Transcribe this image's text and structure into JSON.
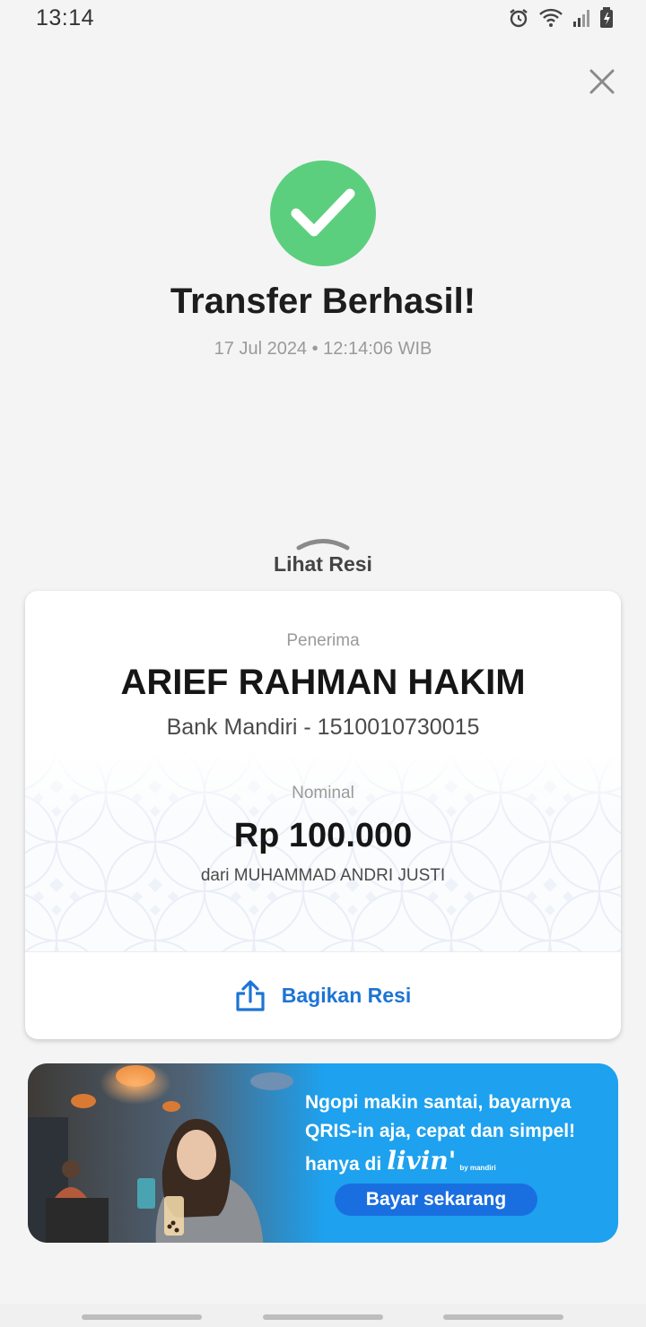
{
  "status_bar": {
    "time": "13:14",
    "icons": [
      "alarm-icon",
      "wifi-icon",
      "signal-icon",
      "battery-icon"
    ]
  },
  "header": {
    "close_icon": "close-icon",
    "success_icon": "check-icon",
    "title": "Transfer Berhasil!",
    "datetime": "17 Jul 2024 • 12:14:06 WIB"
  },
  "receipt_toggle": {
    "label": "Lihat Resi",
    "icon": "chevron-up-icon"
  },
  "receipt": {
    "recipient_label": "Penerima",
    "recipient_name": "ARIEF RAHMAN HAKIM",
    "recipient_bank": "Bank Mandiri - 1510010730015",
    "amount_label": "Nominal",
    "amount": "Rp 100.000",
    "sender": "dari MUHAMMAD ANDRI JUSTI",
    "share_label": "Bagikan Resi",
    "share_icon": "share-icon"
  },
  "banner": {
    "line1": "Ngopi makin santai, bayarnya",
    "line2": "QRIS-in aja, cepat dan simpel!",
    "line3_prefix": "hanya di",
    "brand": "livin'",
    "brand_sub": "by mandiri",
    "cta": "Bayar sekarang"
  },
  "colors": {
    "success": "#5ccf7e",
    "accent": "#1d74d4",
    "banner_bg": "#1ea1ee",
    "cta_bg": "#1a6fe0"
  }
}
